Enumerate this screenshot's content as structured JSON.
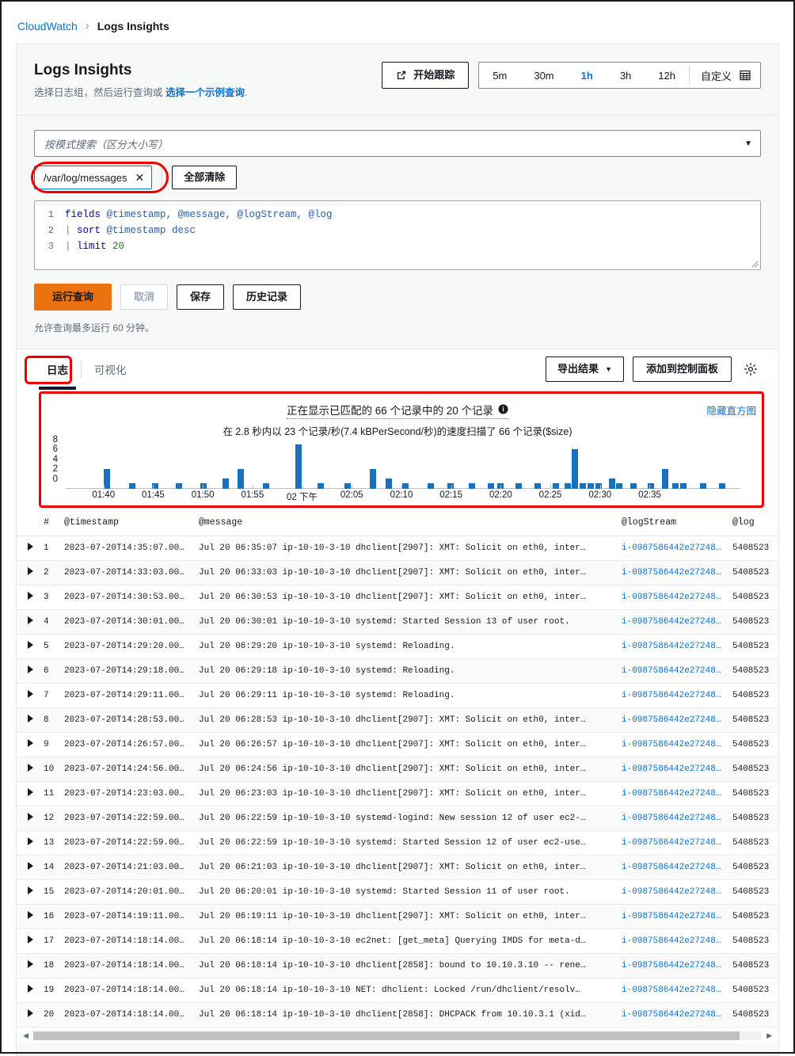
{
  "breadcrumb": {
    "root": "CloudWatch",
    "separator": "›",
    "current": "Logs Insights"
  },
  "header": {
    "title": "Logs Insights",
    "subtitle_prefix": "选择日志组，然后运行查询或 ",
    "subtitle_link": "选择一个示例查询",
    "subtitle_suffix": ".",
    "trace_button": "开始跟踪",
    "trace_icon": "external-link-icon"
  },
  "time_range": {
    "options": [
      "5m",
      "30m",
      "1h",
      "3h",
      "12h"
    ],
    "active": "1h",
    "custom_label": "自定义",
    "custom_icon": "calendar-icon"
  },
  "log_group_select": {
    "placeholder": "按模式搜索（区分大小写）",
    "caret_icon": "chevron-down-icon",
    "token": "/var/log/messages",
    "token_remove_icon": "close-icon",
    "clear_all": "全部清除"
  },
  "editor": {
    "lines": [
      {
        "n": "1",
        "parts": [
          {
            "t": "fields ",
            "c": "kw"
          },
          {
            "t": "@timestamp, @message, @logStream, @log",
            "c": "fld"
          }
        ]
      },
      {
        "n": "2",
        "parts": [
          {
            "t": "| ",
            "c": "pipe"
          },
          {
            "t": "sort ",
            "c": "kw"
          },
          {
            "t": "@timestamp ",
            "c": "fld"
          },
          {
            "t": "desc",
            "c": "fld"
          }
        ]
      },
      {
        "n": "3",
        "parts": [
          {
            "t": "| ",
            "c": "pipe"
          },
          {
            "t": "limit ",
            "c": "kw"
          },
          {
            "t": "20",
            "c": "num"
          }
        ]
      }
    ]
  },
  "actions": {
    "run": "运行查询",
    "cancel": "取消",
    "save": "保存",
    "history": "历史记录",
    "hint": "允许查询最多运行 60 分钟。"
  },
  "tabs": {
    "items": [
      {
        "label": "日志",
        "active": true
      },
      {
        "label": "可视化",
        "active": false
      }
    ],
    "export": "导出结果",
    "export_caret": "▼",
    "add_dashboard": "添加到控制面板",
    "settings_icon": "gear-icon"
  },
  "histogram": {
    "title": "正在显示已匹配的 66 个记录中的 20 个记录",
    "info_icon": "info-icon",
    "subtitle": "在 2.8 秒内以 23 个记录/秒(7.4 kBPerSecond/秒)的速度扫描了 66 个记录($size)",
    "hide_link": "隐藏直方图"
  },
  "chart_data": {
    "type": "bar",
    "title": "正在显示已匹配的 66 个记录中的 20 个记录",
    "xlabel": "",
    "ylabel": "",
    "ylim": [
      0,
      9
    ],
    "yticks": [
      0,
      2,
      4,
      6,
      8
    ],
    "grid": false,
    "legend": false,
    "xtick_labels": [
      "01:40",
      "01:45",
      "01:50",
      "01:55",
      "02 下午",
      "02:05",
      "02:10",
      "02:15",
      "02:20",
      "02:25",
      "02:30",
      "02:35"
    ],
    "xtick_positions_pct": [
      7.0,
      16.2,
      25.4,
      34.6,
      43.8,
      53.0,
      62.2,
      71.4,
      80.6,
      89.8,
      99.0,
      108.2
    ],
    "bars": [
      {
        "x_pct": 7.0,
        "value": 4
      },
      {
        "x_pct": 11.8,
        "value": 1
      },
      {
        "x_pct": 16.0,
        "value": 1
      },
      {
        "x_pct": 20.4,
        "value": 1
      },
      {
        "x_pct": 24.9,
        "value": 1
      },
      {
        "x_pct": 29.0,
        "value": 2
      },
      {
        "x_pct": 31.9,
        "value": 4
      },
      {
        "x_pct": 36.5,
        "value": 1
      },
      {
        "x_pct": 42.6,
        "value": 9
      },
      {
        "x_pct": 46.7,
        "value": 1
      },
      {
        "x_pct": 51.7,
        "value": 1
      },
      {
        "x_pct": 56.3,
        "value": 4
      },
      {
        "x_pct": 59.3,
        "value": 2
      },
      {
        "x_pct": 62.4,
        "value": 1
      },
      {
        "x_pct": 67.0,
        "value": 1
      },
      {
        "x_pct": 70.7,
        "value": 1
      },
      {
        "x_pct": 74.7,
        "value": 1
      },
      {
        "x_pct": 78.2,
        "value": 1
      },
      {
        "x_pct": 80.0,
        "value": 1
      },
      {
        "x_pct": 83.4,
        "value": 1
      },
      {
        "x_pct": 86.9,
        "value": 1
      },
      {
        "x_pct": 90.2,
        "value": 1
      },
      {
        "x_pct": 92.4,
        "value": 1
      },
      {
        "x_pct": 93.8,
        "value": 8
      },
      {
        "x_pct": 95.2,
        "value": 1
      },
      {
        "x_pct": 96.7,
        "value": 1
      },
      {
        "x_pct": 98.2,
        "value": 1
      },
      {
        "x_pct": 100.6,
        "value": 2
      },
      {
        "x_pct": 102.0,
        "value": 1
      },
      {
        "x_pct": 104.6,
        "value": 1
      },
      {
        "x_pct": 107.8,
        "value": 1
      },
      {
        "x_pct": 110.5,
        "value": 4
      },
      {
        "x_pct": 112.4,
        "value": 1
      },
      {
        "x_pct": 113.9,
        "value": 1
      },
      {
        "x_pct": 117.5,
        "value": 1
      },
      {
        "x_pct": 121.0,
        "value": 1
      }
    ]
  },
  "table": {
    "columns": [
      "#",
      "@timestamp",
      "@message",
      "@logStream",
      "@log"
    ],
    "expand_icon": "expand-triangle-icon",
    "rows": [
      {
        "n": "1",
        "ts": "2023-07-20T14:35:07.00…",
        "msg": "Jul 20 06:35:07 ip-10-10-3-10 dhclient[2907]: XMT: Solicit on eth0, inter…",
        "ls": "i-0987586442e27248…",
        "log": "5408523"
      },
      {
        "n": "2",
        "ts": "2023-07-20T14:33:03.00…",
        "msg": "Jul 20 06:33:03 ip-10-10-3-10 dhclient[2907]: XMT: Solicit on eth0, inter…",
        "ls": "i-0987586442e27248…",
        "log": "5408523"
      },
      {
        "n": "3",
        "ts": "2023-07-20T14:30:53.00…",
        "msg": "Jul 20 06:30:53 ip-10-10-3-10 dhclient[2907]: XMT: Solicit on eth0, inter…",
        "ls": "i-0987586442e27248…",
        "log": "5408523"
      },
      {
        "n": "4",
        "ts": "2023-07-20T14:30:01.00…",
        "msg": "Jul 20 06:30:01 ip-10-10-3-10 systemd: Started Session 13 of user root.",
        "ls": "i-0987586442e27248…",
        "log": "5408523"
      },
      {
        "n": "5",
        "ts": "2023-07-20T14:29:20.00…",
        "msg": "Jul 20 06:29:20 ip-10-10-3-10 systemd: Reloading.",
        "ls": "i-0987586442e27248…",
        "log": "5408523"
      },
      {
        "n": "6",
        "ts": "2023-07-20T14:29:18.00…",
        "msg": "Jul 20 06:29:18 ip-10-10-3-10 systemd: Reloading.",
        "ls": "i-0987586442e27248…",
        "log": "5408523"
      },
      {
        "n": "7",
        "ts": "2023-07-20T14:29:11.00…",
        "msg": "Jul 20 06:29:11 ip-10-10-3-10 systemd: Reloading.",
        "ls": "i-0987586442e27248…",
        "log": "5408523"
      },
      {
        "n": "8",
        "ts": "2023-07-20T14:28:53.00…",
        "msg": "Jul 20 06:28:53 ip-10-10-3-10 dhclient[2907]: XMT: Solicit on eth0, inter…",
        "ls": "i-0987586442e27248…",
        "log": "5408523"
      },
      {
        "n": "9",
        "ts": "2023-07-20T14:26:57.00…",
        "msg": "Jul 20 06:26:57 ip-10-10-3-10 dhclient[2907]: XMT: Solicit on eth0, inter…",
        "ls": "i-0987586442e27248…",
        "log": "5408523"
      },
      {
        "n": "10",
        "ts": "2023-07-20T14:24:56.00…",
        "msg": "Jul 20 06:24:56 ip-10-10-3-10 dhclient[2907]: XMT: Solicit on eth0, inter…",
        "ls": "i-0987586442e27248…",
        "log": "5408523"
      },
      {
        "n": "11",
        "ts": "2023-07-20T14:23:03.00…",
        "msg": "Jul 20 06:23:03 ip-10-10-3-10 dhclient[2907]: XMT: Solicit on eth0, inter…",
        "ls": "i-0987586442e27248…",
        "log": "5408523"
      },
      {
        "n": "12",
        "ts": "2023-07-20T14:22:59.00…",
        "msg": "Jul 20 06:22:59 ip-10-10-3-10 systemd-logind: New session 12 of user ec2-…",
        "ls": "i-0987586442e27248…",
        "log": "5408523"
      },
      {
        "n": "13",
        "ts": "2023-07-20T14:22:59.00…",
        "msg": "Jul 20 06:22:59 ip-10-10-3-10 systemd: Started Session 12 of user ec2-use…",
        "ls": "i-0987586442e27248…",
        "log": "5408523"
      },
      {
        "n": "14",
        "ts": "2023-07-20T14:21:03.00…",
        "msg": "Jul 20 06:21:03 ip-10-10-3-10 dhclient[2907]: XMT: Solicit on eth0, inter…",
        "ls": "i-0987586442e27248…",
        "log": "5408523"
      },
      {
        "n": "15",
        "ts": "2023-07-20T14:20:01.00…",
        "msg": "Jul 20 06:20:01 ip-10-10-3-10 systemd: Started Session 11 of user root.",
        "ls": "i-0987586442e27248…",
        "log": "5408523"
      },
      {
        "n": "16",
        "ts": "2023-07-20T14:19:11.00…",
        "msg": "Jul 20 06:19:11 ip-10-10-3-10 dhclient[2907]: XMT: Solicit on eth0, inter…",
        "ls": "i-0987586442e27248…",
        "log": "5408523"
      },
      {
        "n": "17",
        "ts": "2023-07-20T14:18:14.00…",
        "msg": "Jul 20 06:18:14 ip-10-10-3-10 ec2net: [get_meta] Querying IMDS for meta-d…",
        "ls": "i-0987586442e27248…",
        "log": "5408523"
      },
      {
        "n": "18",
        "ts": "2023-07-20T14:18:14.00…",
        "msg": "Jul 20 06:18:14 ip-10-10-3-10 dhclient[2858]: bound to 10.10.3.10 -- rene…",
        "ls": "i-0987586442e27248…",
        "log": "5408523"
      },
      {
        "n": "19",
        "ts": "2023-07-20T14:18:14.00…",
        "msg": "Jul 20 06:18:14 ip-10-10-3-10 NET: dhclient: Locked /run/dhclient/resolv…",
        "ls": "i-0987586442e27248…",
        "log": "5408523"
      },
      {
        "n": "20",
        "ts": "2023-07-20T14:18:14.00…",
        "msg": "Jul 20 06:18:14 ip-10-10-3-10 dhclient[2858]: DHCPACK from 10.10.3.1 (xid…",
        "ls": "i-0987586442e27248…",
        "log": "5408523"
      }
    ]
  },
  "colors": {
    "accent_blue": "#0972d3",
    "bar_blue": "#1a70ba",
    "run_orange": "#ec7211",
    "annotation_red": "#ee0000"
  }
}
